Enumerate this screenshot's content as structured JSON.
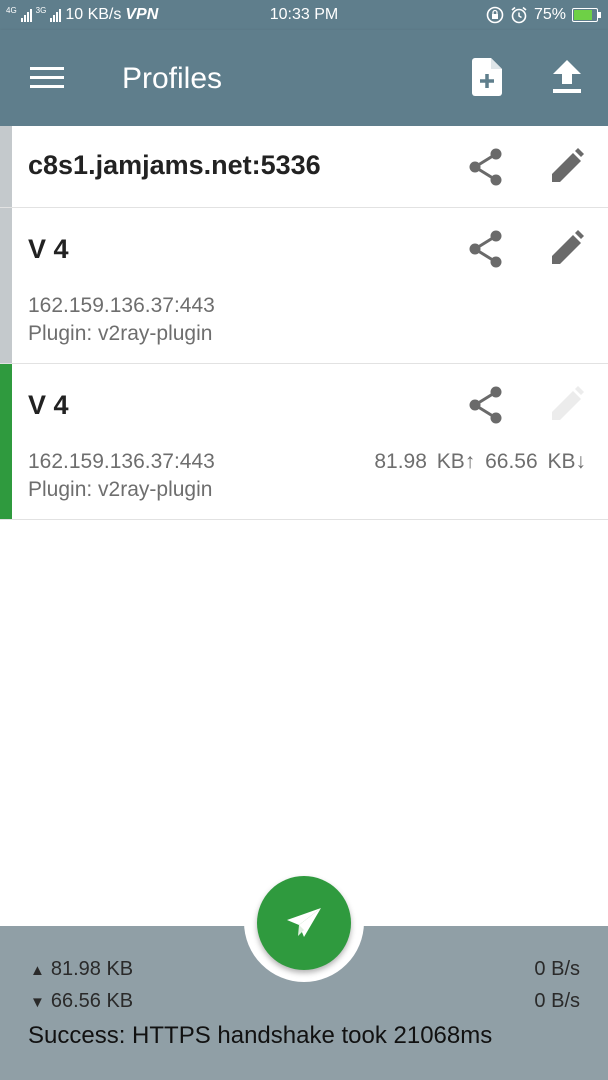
{
  "status_bar": {
    "network_type_1": "4G",
    "network_type_2": "3G",
    "speed": "10 KB/s",
    "vpn": "VPN",
    "time": "10:33 PM",
    "battery": "75%"
  },
  "app_bar": {
    "title": "Profiles",
    "icons": [
      "menu-icon",
      "add-file-icon",
      "upload-icon"
    ]
  },
  "profiles": [
    {
      "name": "c8s1.jamjams.net:5336",
      "address": "",
      "plugin": "",
      "traffic": "",
      "selected": false,
      "edit_enabled": true
    },
    {
      "name": "V 4",
      "address": "162.159.136.37:443",
      "plugin": "Plugin: v2ray-plugin",
      "traffic": "",
      "selected": false,
      "edit_enabled": true
    },
    {
      "name": "V 4",
      "address": "162.159.136.37:443",
      "plugin": "Plugin: v2ray-plugin",
      "traffic": "81.98 KB↑ 66.56 KB↓",
      "selected": true,
      "edit_enabled": false
    }
  ],
  "stats": {
    "tx_total": "81.98 KB",
    "rx_total": "66.56 KB",
    "tx_rate": "0 B/s",
    "rx_rate": "0 B/s",
    "message": "Success: HTTPS handshake took 21068ms"
  },
  "colors": {
    "app_bar": "#5f7e8c",
    "accent_green": "#2f9a3e",
    "bottom_bar": "#909fa6",
    "stripe_inactive": "#c4c9cc"
  }
}
